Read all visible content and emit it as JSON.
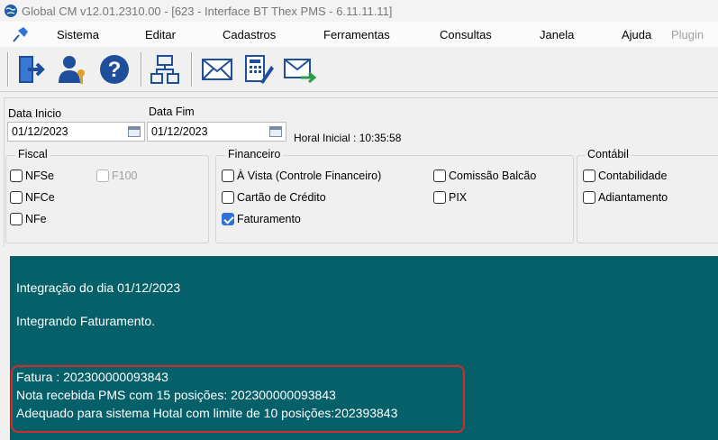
{
  "window": {
    "title": "Global CM v12.01.2310.00 - [623 - Interface BT Thex PMS - 6.11.11.11]"
  },
  "menu": {
    "items": [
      "Sistema",
      "Editar",
      "Cadastros",
      "Ferramentas",
      "Consultas",
      "Janela",
      "Ajuda"
    ],
    "plugin": "Plugin"
  },
  "toolbar": {
    "buttons": [
      "exit-icon",
      "user-key-icon",
      "help-icon",
      "sitemap-icon",
      "mail-icon",
      "calculator-doc-icon",
      "mail-send-icon"
    ]
  },
  "form": {
    "data_inicio_label": "Data Inicio",
    "data_inicio_value": "01/12/2023",
    "data_fim_label": "Data Fim",
    "data_fim_value": "01/12/2023",
    "horal_inicial": "Horal Inicial : 10:35:58"
  },
  "fiscal": {
    "title": "Fiscal",
    "nfse": "NFSe",
    "f100": "F100",
    "nfce": "NFCe",
    "nfe": "NFe"
  },
  "financeiro": {
    "title": "Financeiro",
    "a_vista": "À Vista (Controle Financeiro)",
    "comissao": "Comissão Balcão",
    "cartao": "Cartão de Crédito",
    "pix": "PIX",
    "faturamento": "Faturamento",
    "faturamento_checked": true
  },
  "contabil": {
    "title": "Contábil",
    "contabilidade": "Contabilidade",
    "adiantamento": "Adiantamento"
  },
  "log": {
    "line1": "Integração do dia 01/12/2023",
    "line2": "Integrando Faturamento.",
    "line3": "Fatura : 202300000093843",
    "line4": "Nota recebida PMS com 15 posições: 202300000093843",
    "line5": "Adequado para sistema Hotal com limite de 10 posições:202393843"
  },
  "colors": {
    "log_background": "#05606a",
    "highlight_border": "#d42a2a",
    "checkbox_checked": "#2f73d8"
  }
}
